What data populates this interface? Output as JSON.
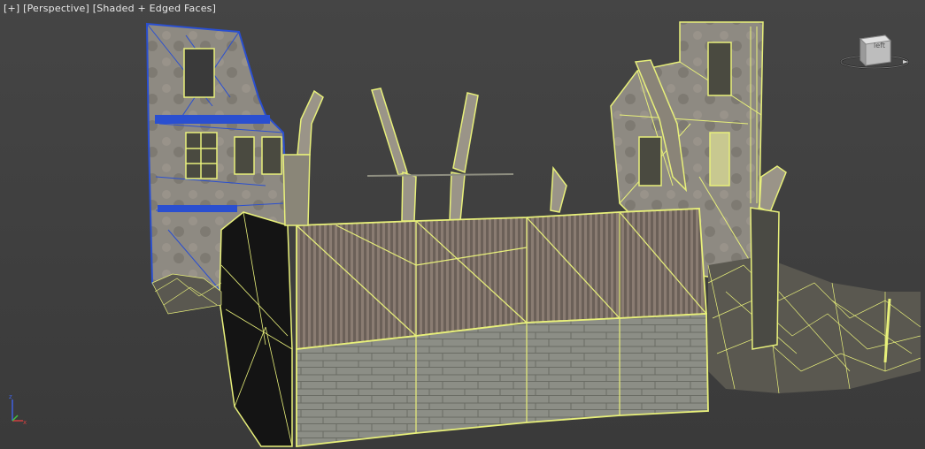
{
  "viewport": {
    "menu_plus": "[+]",
    "menu_view": "[Perspective]",
    "menu_shading": "[Shaded + Edged Faces]"
  },
  "viewcube": {
    "face_label": "left",
    "icon": "viewcube-icon"
  },
  "axis_tripod": {
    "icon": "axis-tripod-icon",
    "x_color": "#d04040",
    "y_color": "#40c040",
    "z_color": "#4060e0"
  },
  "colors": {
    "selection_wire": "#e8f07a",
    "selected_object_wire": "#2a4fd0",
    "background": "#3d3d3d"
  }
}
